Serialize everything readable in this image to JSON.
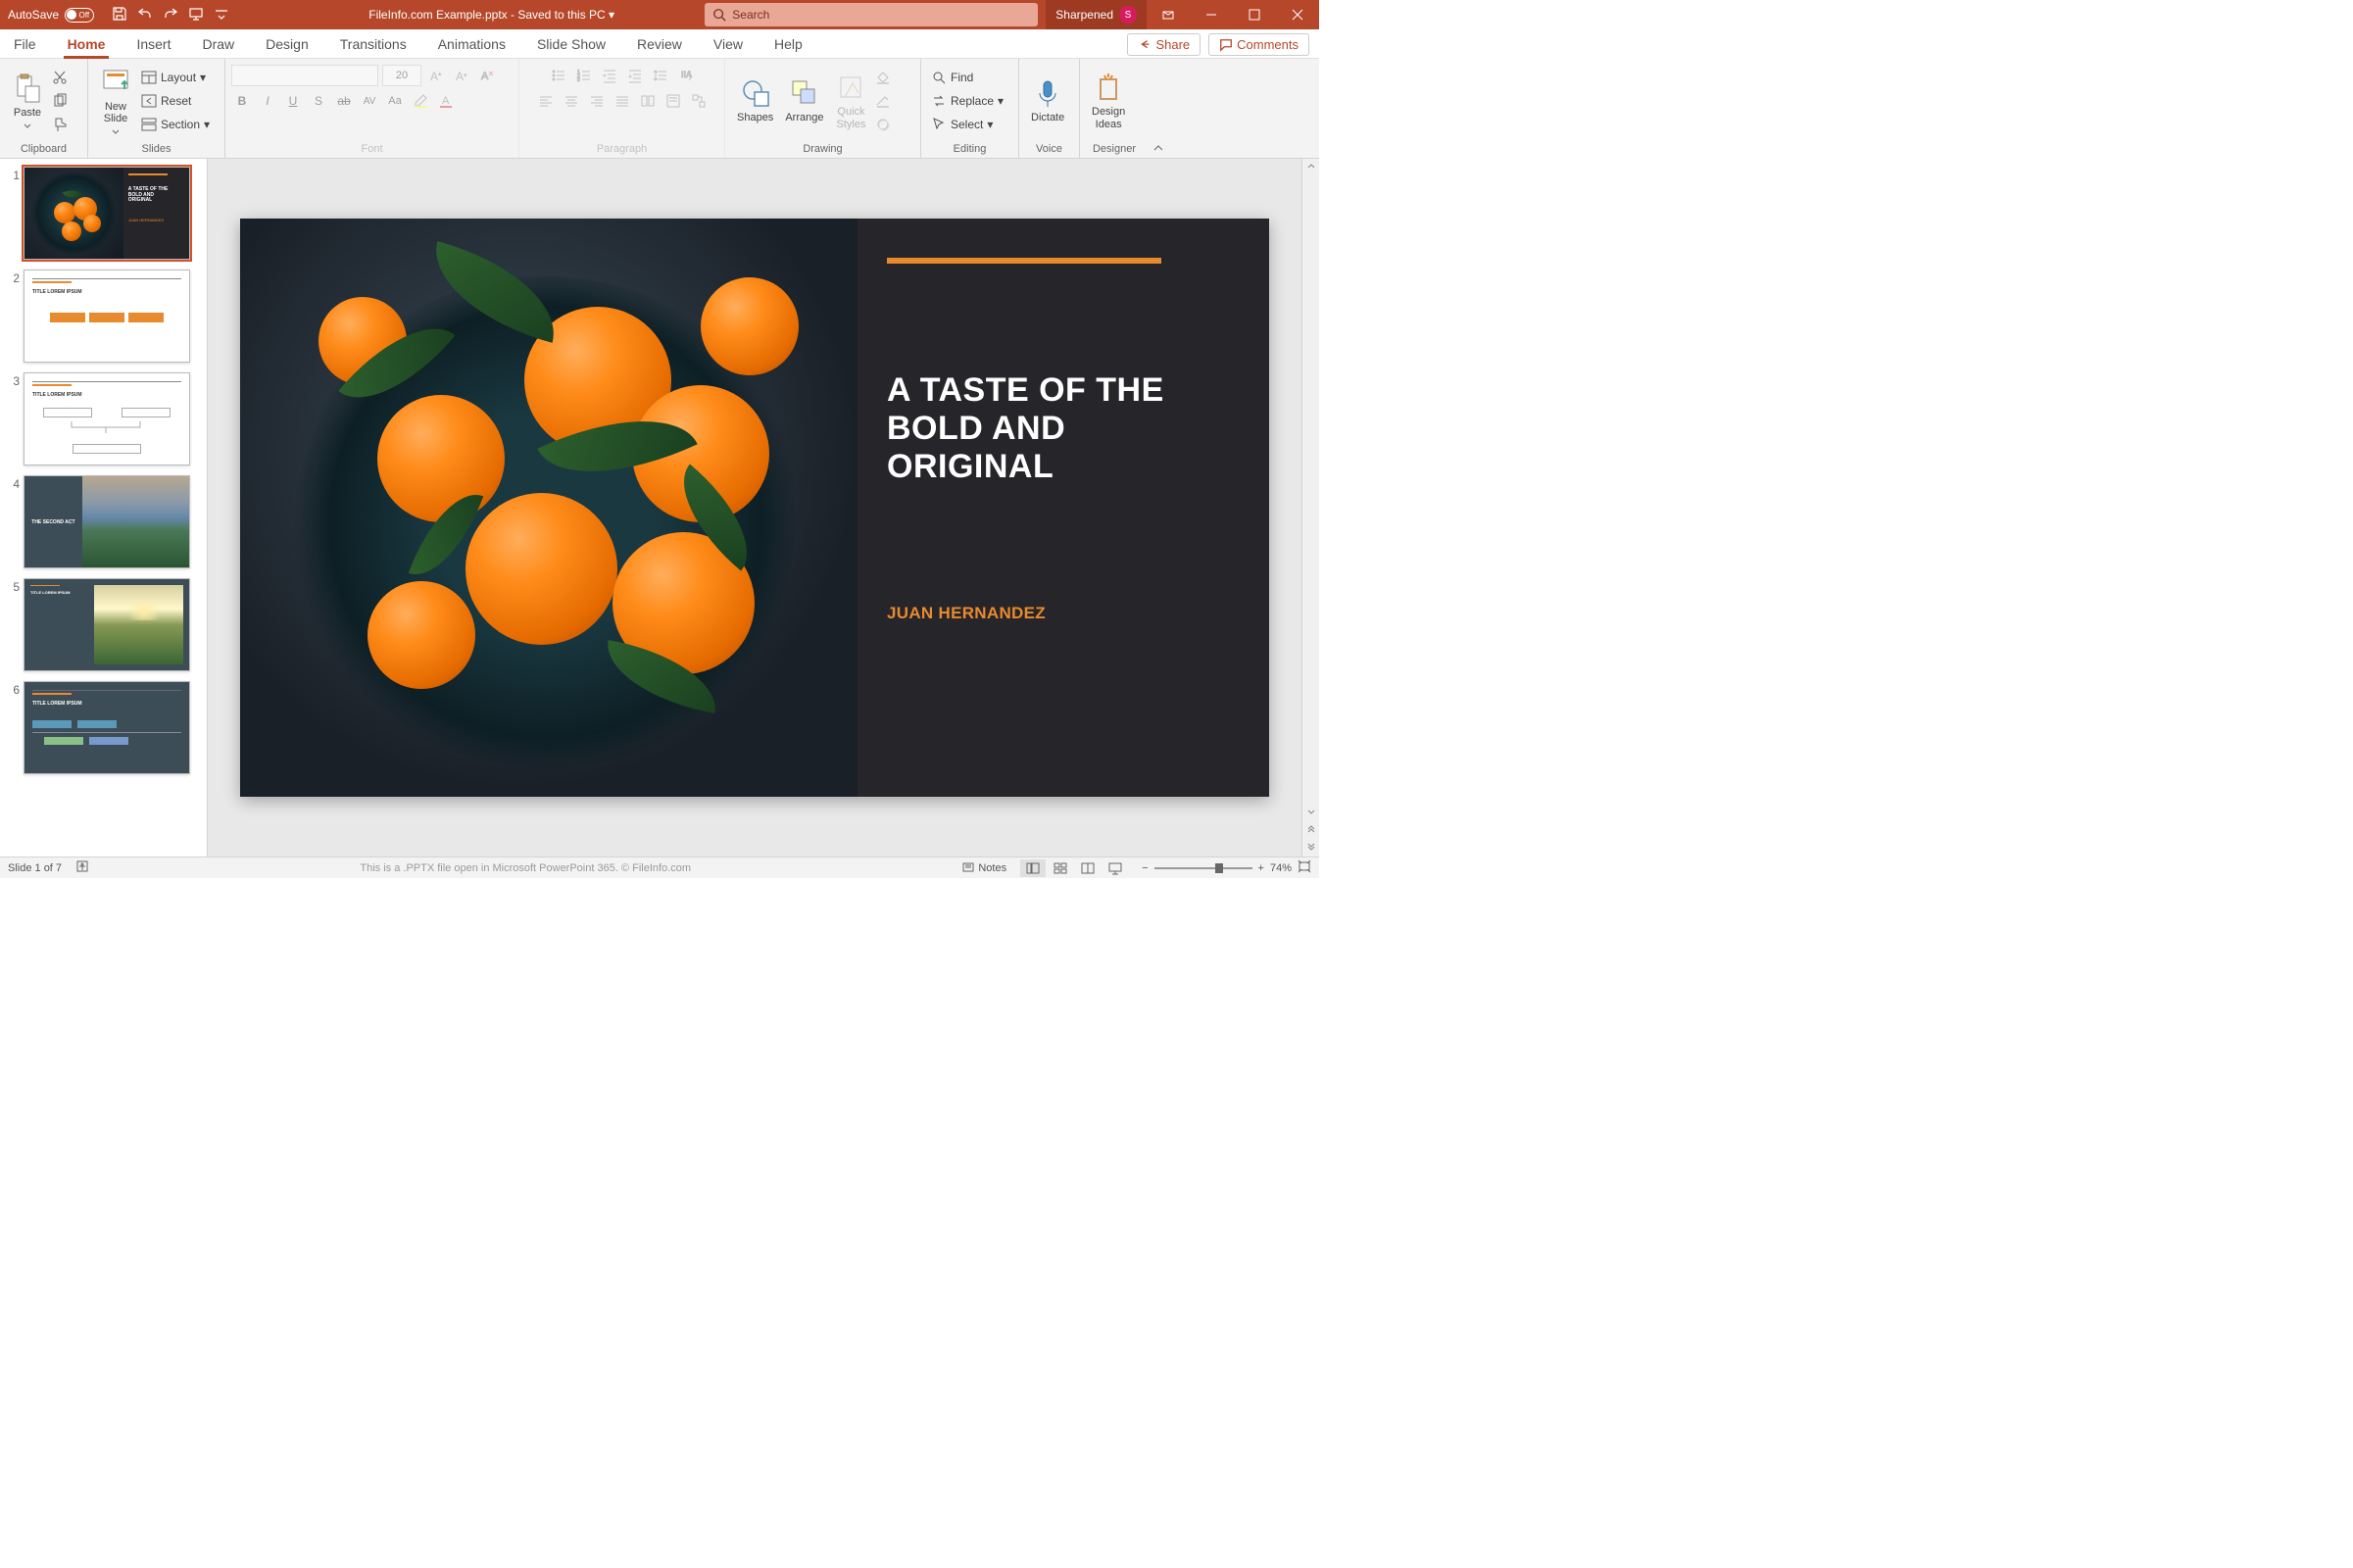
{
  "titlebar": {
    "autosave_label": "AutoSave",
    "autosave_state": "Off",
    "doc_title": "FileInfo.com Example.pptx  -  Saved to this PC ▾",
    "search_placeholder": "Search",
    "user_name": "Sharpened",
    "user_initial": "S"
  },
  "tabs": [
    "File",
    "Home",
    "Insert",
    "Draw",
    "Design",
    "Transitions",
    "Animations",
    "Slide Show",
    "Review",
    "View",
    "Help"
  ],
  "active_tab": "Home",
  "share_label": "Share",
  "comments_label": "Comments",
  "ribbon": {
    "clipboard": {
      "label": "Clipboard",
      "paste": "Paste"
    },
    "slides": {
      "label": "Slides",
      "newslide": "New\nSlide",
      "layout": "Layout",
      "reset": "Reset",
      "section": "Section"
    },
    "font": {
      "label": "Font",
      "size": "20"
    },
    "paragraph": {
      "label": "Paragraph"
    },
    "drawing": {
      "label": "Drawing",
      "shapes": "Shapes",
      "arrange": "Arrange",
      "quickstyles": "Quick\nStyles"
    },
    "editing": {
      "label": "Editing",
      "find": "Find",
      "replace": "Replace",
      "select": "Select"
    },
    "voice": {
      "label": "Voice",
      "dictate": "Dictate"
    },
    "designer": {
      "label": "Designer",
      "ideas": "Design\nIdeas"
    }
  },
  "slide": {
    "title": "A TASTE OF THE BOLD AND ORIGINAL",
    "author": "JUAN HERNANDEZ"
  },
  "thumbs": [
    {
      "num": "1",
      "kind": "title-dark"
    },
    {
      "num": "2",
      "kind": "timeline-light"
    },
    {
      "num": "3",
      "kind": "flow-light"
    },
    {
      "num": "4",
      "kind": "image-split"
    },
    {
      "num": "5",
      "kind": "image-text"
    },
    {
      "num": "6",
      "kind": "timeline-dark"
    }
  ],
  "thumb_labels": {
    "t2_title": "TITLE LOREM IPSUM",
    "t3_title": "TITLE LOREM IPSUM",
    "t4_title": "THE SECOND ACT",
    "t5_title": "TITLE LOREM IPSUM",
    "t6_title": "TITLE LOREM IPSUM"
  },
  "status": {
    "slide_pos": "Slide 1 of 7",
    "footer_msg": "This is a .PPTX file open in Microsoft PowerPoint 365. © FileInfo.com",
    "notes": "Notes",
    "zoom": "74%"
  }
}
